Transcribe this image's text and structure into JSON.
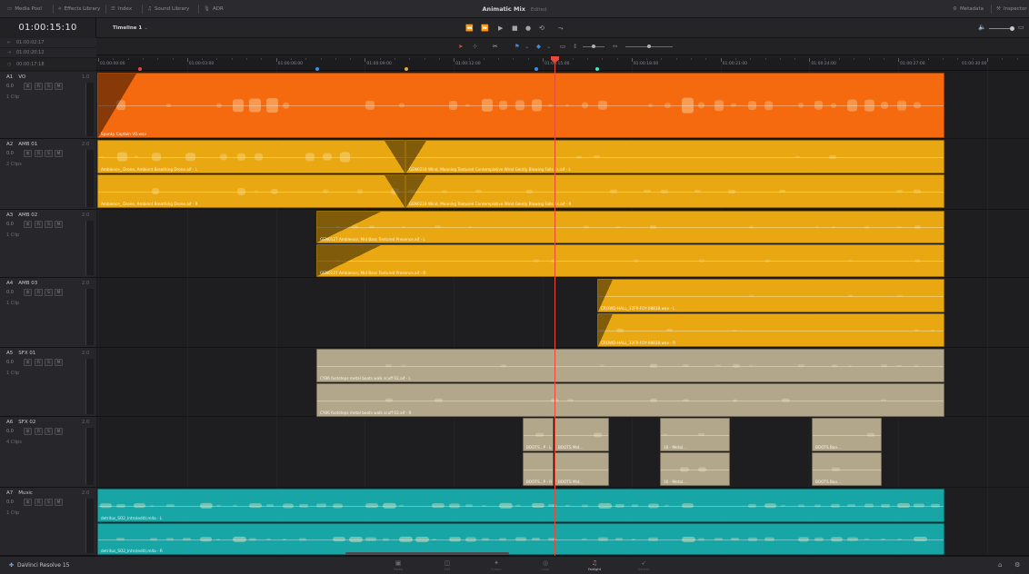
{
  "topbar": {
    "left_items": [
      {
        "icon": "media-pool-icon",
        "glyph": "▭",
        "label": "Media Pool"
      },
      {
        "icon": "effects-library-icon",
        "glyph": "⟡",
        "label": "Effects Library"
      },
      {
        "icon": "index-icon",
        "glyph": "☰",
        "label": "Index"
      },
      {
        "icon": "sound-library-icon",
        "glyph": "♫",
        "label": "Sound Library"
      },
      {
        "icon": "adr-icon",
        "glyph": "🎙",
        "label": "ADR"
      }
    ],
    "title": "Animatic Mix",
    "title_status": "Edited",
    "right_items": [
      {
        "icon": "metadata-icon",
        "glyph": "⚙",
        "label": "Metadata"
      },
      {
        "icon": "inspector-icon",
        "glyph": "⚒",
        "label": "Inspector"
      }
    ]
  },
  "timecode": "01:00:15:10",
  "timeline_name": "Timeline 1",
  "transport": [
    "⏪",
    "⏩",
    "▶",
    "■",
    "●",
    "⟲",
    "⤳"
  ],
  "left_timecodes": [
    {
      "icon": "in-icon",
      "glyph": "⇤",
      "value": "01:00:02:17"
    },
    {
      "icon": "out-icon",
      "glyph": "⇥",
      "value": "01:00:20:12"
    },
    {
      "icon": "duration-icon",
      "glyph": "◷",
      "value": "00:00:17:18"
    }
  ],
  "ruler": {
    "labels": [
      "01:00:00:00",
      "01:00:03:00",
      "01:00:06:00",
      "01:00:09:00",
      "01:00:12:00",
      "01:00:15:00",
      "01:00:18:00",
      "01:00:21:00",
      "01:00:24:00",
      "01:00:27:00",
      "01:00:30:00"
    ],
    "markers": [
      {
        "t": 0.045,
        "color": "#e8453c"
      },
      {
        "t": 0.235,
        "color": "#3b8ee8"
      },
      {
        "t": 0.33,
        "color": "#e8a33c"
      },
      {
        "t": 0.47,
        "color": "#3b8ee8"
      },
      {
        "t": 0.535,
        "color": "#3ce8c0"
      }
    ]
  },
  "tracks": [
    {
      "id": "A1",
      "name": "VO",
      "ch": "1.0",
      "vol": "0.0",
      "clips_label": "1 Clip"
    },
    {
      "id": "A2",
      "name": "AMB 01",
      "ch": "2.0",
      "vol": "0.0",
      "clips_label": "2 Clips"
    },
    {
      "id": "A3",
      "name": "AMB 02",
      "ch": "2.0",
      "vol": "0.0",
      "clips_label": "1 Clip"
    },
    {
      "id": "A4",
      "name": "AMB 03",
      "ch": "2.0",
      "vol": "0.0",
      "clips_label": "1 Clip"
    },
    {
      "id": "A5",
      "name": "SFX 01",
      "ch": "2.0",
      "vol": "0.0",
      "clips_label": "1 Clip"
    },
    {
      "id": "A6",
      "name": "SFX 02",
      "ch": "2.0",
      "vol": "0.0",
      "clips_label": "4 Clips"
    },
    {
      "id": "A7",
      "name": "Music",
      "ch": "2.0",
      "vol": "0.0",
      "clips_label": "1 Clip"
    }
  ],
  "header_buttons": [
    "R",
    "S",
    "M"
  ],
  "clips": {
    "vo": "Spunky Captain VO.wav",
    "amb01a_l": "Ambience_ Drone, Ambient Breathing Drone.aif - L",
    "amb01a_r": "Ambience_ Drone, Ambient Breathing Drone.aif - R",
    "amb01b_l": "GEN0218 Wind, Moaning Textured Contemplative Wind Gently Blowing Falls.4s.aif - L",
    "amb01b_r": "GEN0218 Wind, Moaning Textured Contemplative Wind Gently Blowing Falls.4s.aif - R",
    "amb02_l": "GEN0127 Ambience, Mid Bass Textured Presence.aif - L",
    "amb02_r": "GEN0127 Ambience, Mid Bass Textured Presence.aif - R",
    "amb03_l": "CROWD-HALL_32FR-FOY-08838.wav - L",
    "amb03_r": "CROWD-HALL_32FR-FOY-08838.wav - R",
    "sfx01_l": "CY86 footsteps metal boots walk scuff 02.aif - L",
    "sfx01_r": "CY86 footsteps metal boots walk scuff 02.aif - R",
    "sfx02": [
      "BOOTS...P - L",
      "BOOTS Mid...",
      "16 - Metal...",
      "BOOTS Boo...",
      "BOOTS...P - R",
      "BOOTS Mid...",
      "16 - Metal...",
      "BOOTS Boo..."
    ],
    "music_l": "detritus_SO2_Intro(edit).m4a - L",
    "music_r": "detritus_SO2_Intro(edit).m4a - R"
  },
  "brand": "DaVinci Resolve 15",
  "pages": [
    {
      "icon": "media-page-icon",
      "glyph": "▣",
      "label": "Media"
    },
    {
      "icon": "edit-page-icon",
      "glyph": "◫",
      "label": "Edit"
    },
    {
      "icon": "fusion-page-icon",
      "glyph": "✦",
      "label": "Fusion"
    },
    {
      "icon": "color-page-icon",
      "glyph": "◎",
      "label": "Color"
    },
    {
      "icon": "fairlight-page-icon",
      "glyph": "♫",
      "label": "Fairlight",
      "active": true
    },
    {
      "icon": "deliver-page-icon",
      "glyph": "➶",
      "label": "Deliver"
    }
  ],
  "colors": {
    "vo": "#f5690f",
    "amb": "#e9a712",
    "sfx": "#b3a78b",
    "music": "#17a5a5",
    "playhead": "#e84a3a"
  }
}
